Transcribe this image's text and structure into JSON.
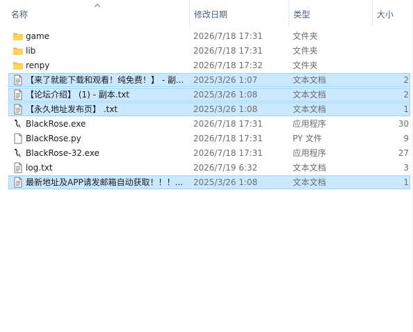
{
  "columns": {
    "name": "名称",
    "date": "修改日期",
    "type": "类型",
    "size": "大小"
  },
  "files": [
    {
      "name": "game",
      "date": "2026/7/18 17:31",
      "type": "文件夹",
      "size": "",
      "icon": "folder-icon",
      "selected": false
    },
    {
      "name": "lib",
      "date": "2026/7/18 17:31",
      "type": "文件夹",
      "size": "",
      "icon": "folder-icon",
      "selected": false
    },
    {
      "name": "renpy",
      "date": "2026/7/18 17:32",
      "type": "文件夹",
      "size": "",
      "icon": "folder-icon",
      "selected": false
    },
    {
      "name": "【来了就能下载和观看！纯免费！】 - 副...",
      "date": "2025/3/26 1:07",
      "type": "文本文档",
      "size": "2",
      "icon": "text-file-icon",
      "selected": true
    },
    {
      "name": "【论坛介绍】 (1) - 副本.txt",
      "date": "2025/3/26 1:08",
      "type": "文本文档",
      "size": "2",
      "icon": "text-file-icon",
      "selected": true
    },
    {
      "name": "【永久地址发布页】 .txt",
      "date": "2025/3/26 1:08",
      "type": "文本文档",
      "size": "1",
      "icon": "text-file-icon",
      "selected": true
    },
    {
      "name": "BlackRose.exe",
      "date": "2026/7/18 17:31",
      "type": "应用程序",
      "size": "30",
      "icon": "executable-icon",
      "selected": false
    },
    {
      "name": "BlackRose.py",
      "date": "2026/7/18 17:31",
      "type": "PY 文件",
      "size": "9",
      "icon": "blank-file-icon",
      "selected": false
    },
    {
      "name": "BlackRose-32.exe",
      "date": "2026/7/18 17:31",
      "type": "应用程序",
      "size": "27",
      "icon": "executable-icon",
      "selected": false
    },
    {
      "name": "log.txt",
      "date": "2026/7/19 6:32",
      "type": "文本文档",
      "size": "3",
      "icon": "text-file-icon",
      "selected": false
    },
    {
      "name": "最新地址及APP请发邮箱自动获取！！！...",
      "date": "2025/3/26 1:08",
      "type": "文本文档",
      "size": "1",
      "icon": "text-file-icon",
      "selected": true
    }
  ],
  "colors": {
    "selection_fill": "#cce8ff",
    "selection_border": "#99d1ff",
    "folder_yellow": "#ffd35c",
    "header_text": "#4c607a"
  }
}
